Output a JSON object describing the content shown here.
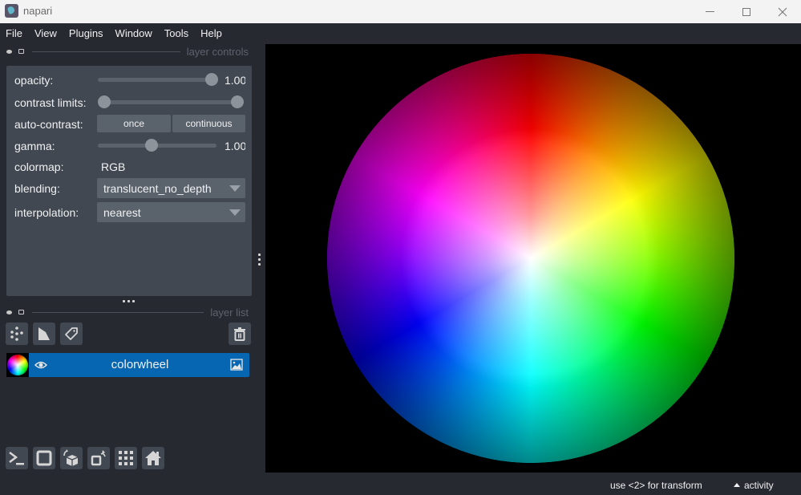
{
  "window": {
    "title": "napari",
    "icons": [
      "napari-logo-icon",
      "minimize-icon",
      "maximize-icon",
      "close-icon"
    ]
  },
  "menu": {
    "items": [
      "File",
      "View",
      "Plugins",
      "Window",
      "Tools",
      "Help"
    ]
  },
  "layer_controls": {
    "title": "layer controls",
    "opacity": {
      "label": "opacity:",
      "value": "1.00",
      "fraction": 1.0
    },
    "contrast_limits": {
      "label": "contrast limits:",
      "low_fraction": 0.0,
      "high_fraction": 1.0
    },
    "auto_contrast": {
      "label": "auto-contrast:",
      "once": "once",
      "continuous": "continuous"
    },
    "gamma": {
      "label": "gamma:",
      "value": "1.00",
      "fraction": 0.45
    },
    "colormap": {
      "label": "colormap:",
      "value": "RGB"
    },
    "blending": {
      "label": "blending:",
      "value": "translucent_no_depth"
    },
    "interpolation": {
      "label": "interpolation:",
      "value": "nearest"
    }
  },
  "layer_list": {
    "title": "layer list",
    "buttons": [
      "new-points-layer",
      "new-shapes-layer",
      "new-labels-layer",
      "delete-layer"
    ],
    "layers": [
      {
        "name": "colorwheel",
        "visible": true,
        "type": "image"
      }
    ]
  },
  "viewer_buttons": [
    "console",
    "ndisplay-toggle",
    "roll-dims",
    "transpose-dims",
    "grid-view",
    "reset-view"
  ],
  "status": {
    "message": "use <2> for transform",
    "activity": "activity"
  },
  "colors": {
    "background": "#262930",
    "panel": "#414851",
    "control": "#5a626c",
    "selected_layer": "#0766b1",
    "canvas": "#000000"
  }
}
